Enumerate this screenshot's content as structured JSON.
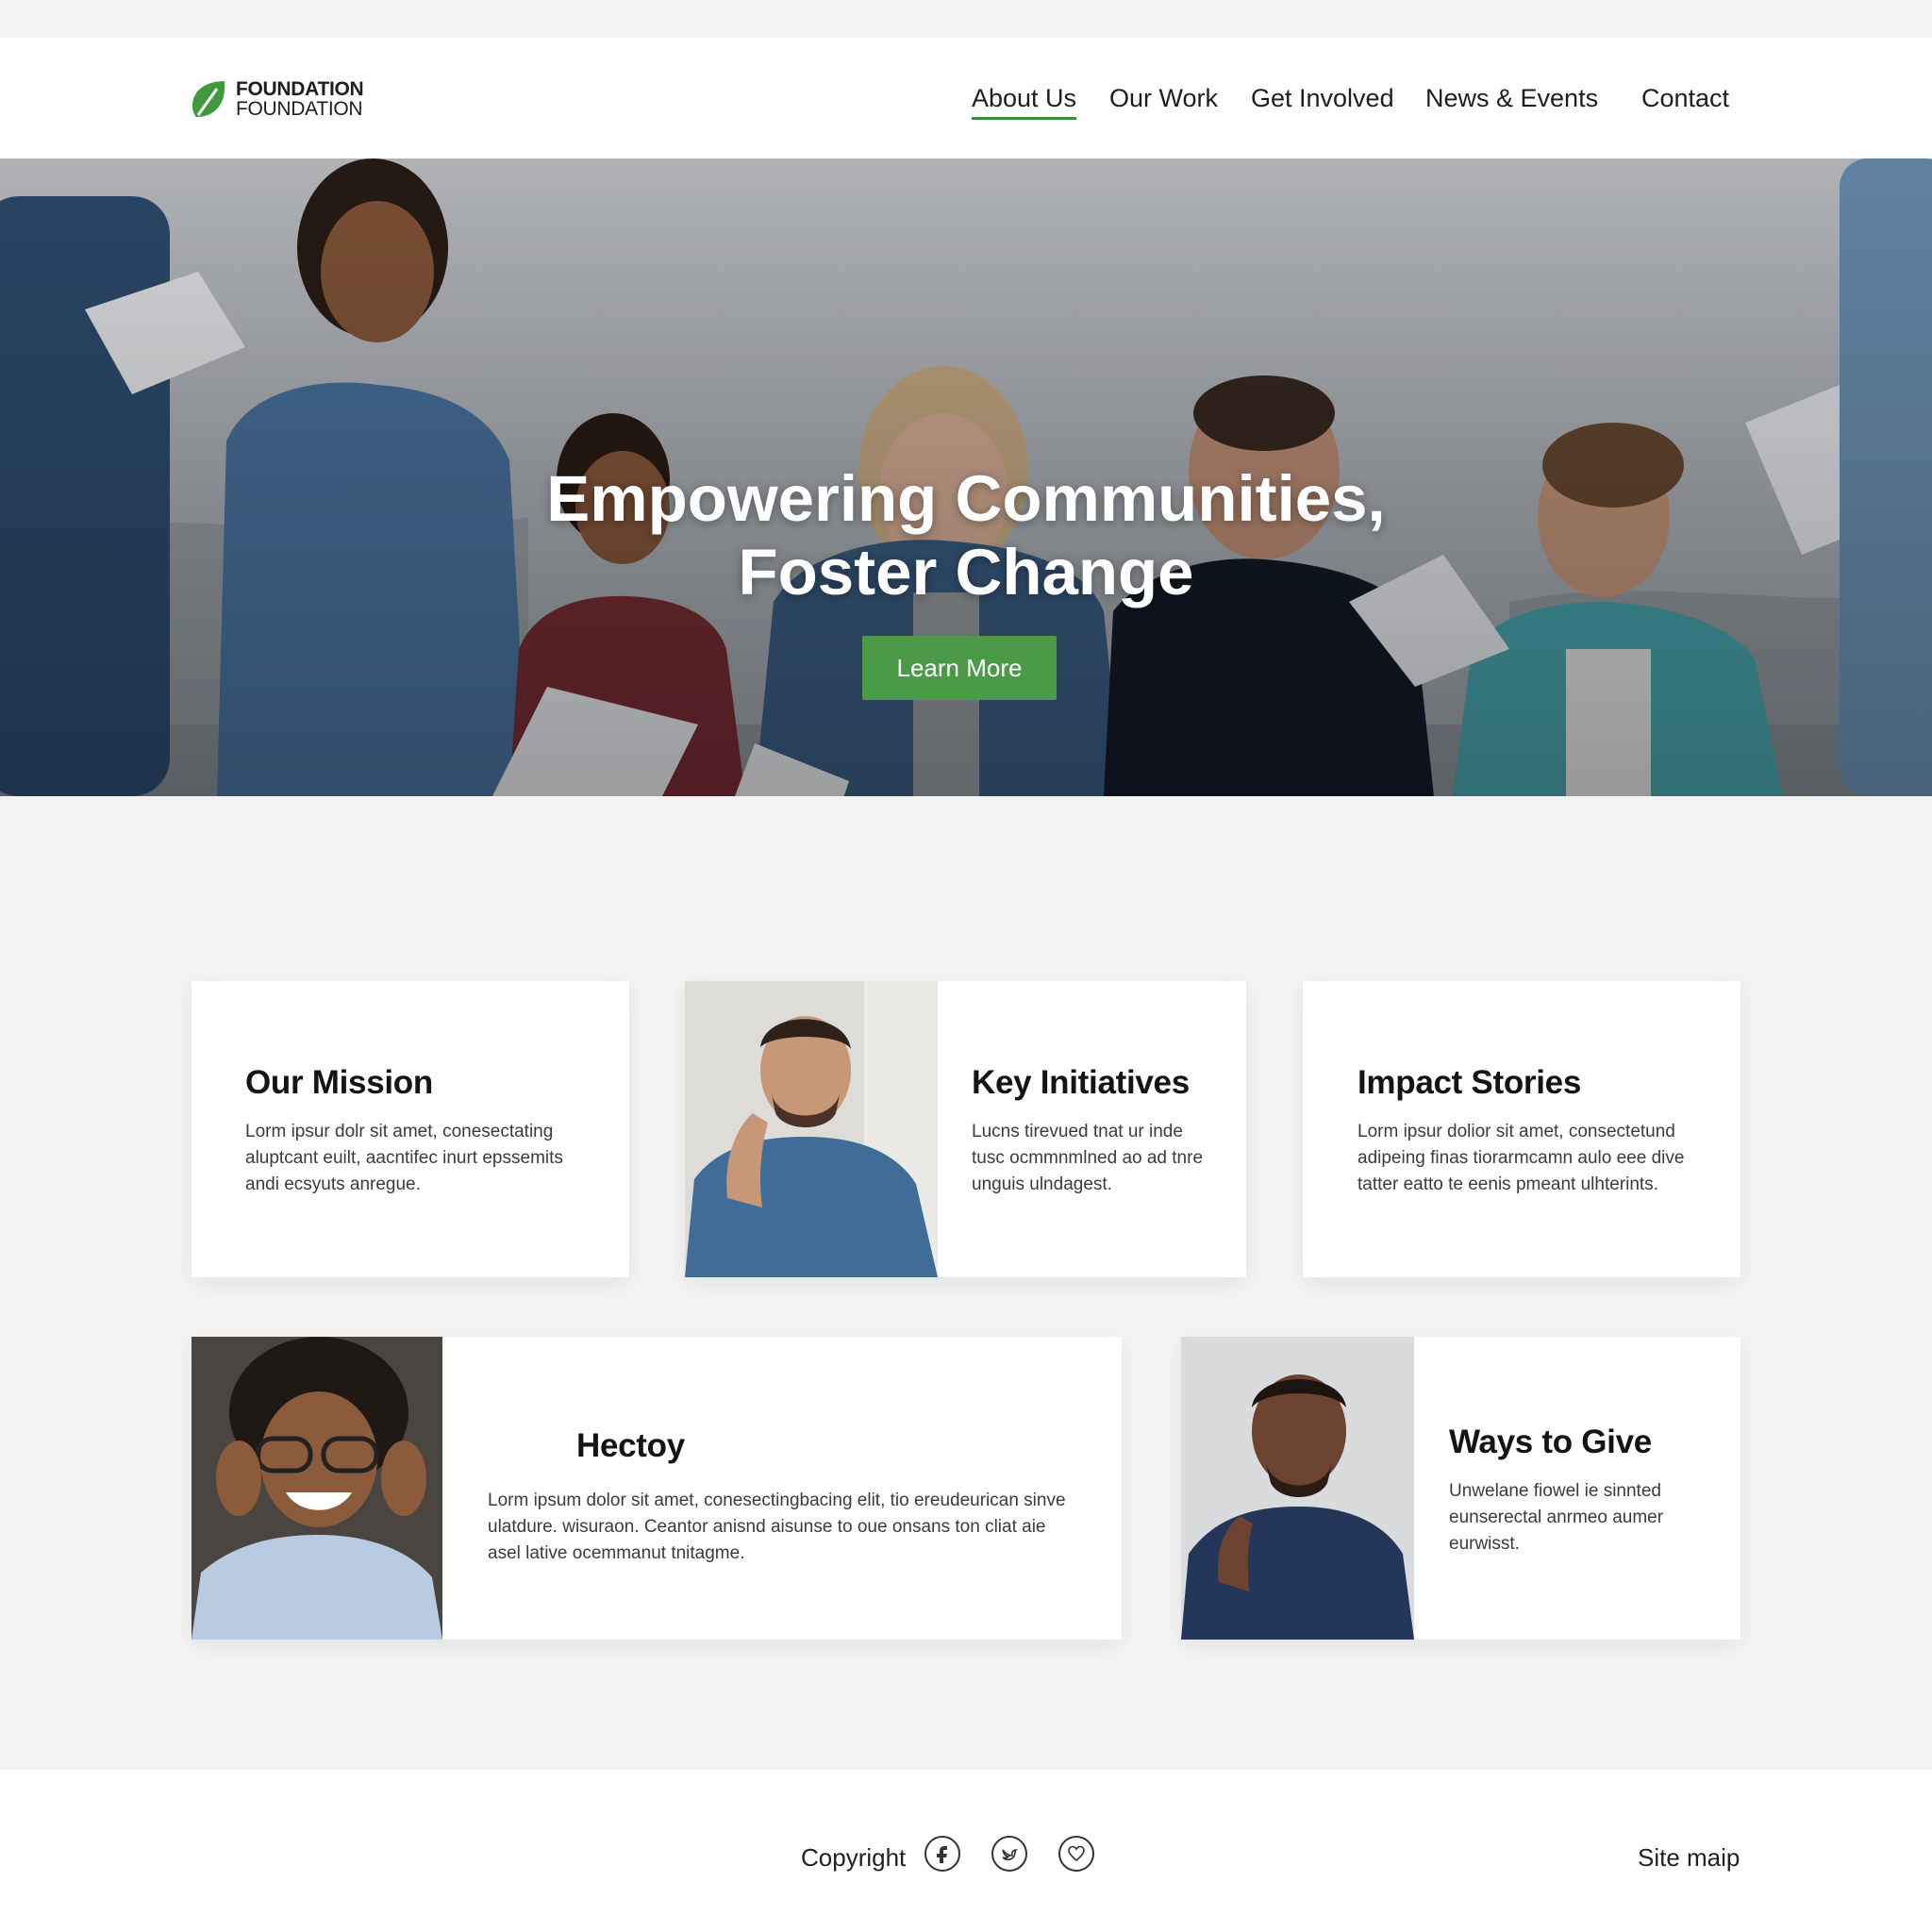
{
  "brand": {
    "line1": "FOUNDATION",
    "line2": "FOUNDATION",
    "accent": "#3b8f3c",
    "logo_icon": "leaf-icon"
  },
  "nav": {
    "items": [
      {
        "label": "About Us",
        "active": true
      },
      {
        "label": "Our Work"
      },
      {
        "label": "Get Involved"
      },
      {
        "label": "News & Events"
      },
      {
        "label": "Contact"
      }
    ]
  },
  "hero": {
    "title_line1": "Empowering Communities,",
    "title_line2": "Foster Change",
    "button_label": "Learn More",
    "button_color": "#4a9a47"
  },
  "cards": {
    "mission": {
      "title": "Our Mission",
      "text": "Lorm ipsur dolr sit amet, conesectating aluptcant euilt, aacntifec inurt epssemits andi ecsyuts anregue."
    },
    "initiatives": {
      "title": "Key Initiatives",
      "text": "Lucns tirevued tnat ur inde tusc ocmmnmlned ao ad tnre unguis ulndagest."
    },
    "impact": {
      "title": "Impact Stories",
      "text": "Lorm ipsur dolior sit amet, consectetund adipeing finas tiorarmcamn aulo eee dive tatter eatto te eenis pmeant ulhterints."
    },
    "hectoy": {
      "title": "Hectoy",
      "text": "Lorm ipsum dolor sit amet, conesectingbacing elit, tio ereudeurican sinve ulatdure. wisuraon. Ceantor anisnd aisunse to oue onsans ton cliat aie asel lative ocemmanut tnitagme."
    },
    "give": {
      "title": "Ways to Give",
      "text": "Unwelane fiowel ie sinnted eunserectal anrmeo aumer eurwisst."
    }
  },
  "footer": {
    "copyright": "Copyright",
    "social_icons": [
      "facebook-icon",
      "twitter-icon",
      "heart-icon"
    ],
    "sitemap": "Site maip"
  }
}
